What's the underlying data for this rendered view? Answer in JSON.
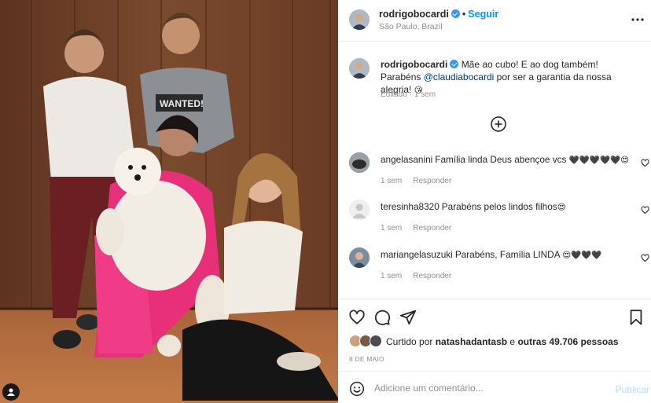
{
  "post": {
    "username": "rodrigobocardi",
    "separator": "•",
    "follow_label": "Seguir",
    "location": "São Paulo, Brazil",
    "photo_alt": "family with dog"
  },
  "caption": {
    "username": "rodrigobocardi",
    "text_a": "Mãe ao cubo! E ao dog também! Parabéns",
    "mention": "@claudiabocardi",
    "text_b": "por ser a garantia da nossa alegria!",
    "emoji": "😘",
    "edited": "Editado",
    "dot": "·",
    "time": "1 sem"
  },
  "comments": [
    {
      "username": "angelasanini",
      "text": "Família linda Deus abençoe vcs",
      "emoji": "🖤🖤🖤🖤🖤😍",
      "time": "1 sem",
      "reply": "Responder",
      "avatar_color": "#3a3a3a"
    },
    {
      "username": "teresinha8320",
      "text": "Parabéns pelos lindos filhos",
      "emoji": "😍",
      "time": "1 sem",
      "reply": "Responder",
      "avatar_color": "#dbdbdb"
    },
    {
      "username": "mariangelasuzuki",
      "text": "Parabéns, Família LINDA",
      "emoji": "😍🖤🖤🖤",
      "time": "1 sem",
      "reply": "Responder",
      "avatar_color": "#5a6b7d"
    }
  ],
  "likes": {
    "prefix": "Curtido por",
    "user": "natashadantasb",
    "middle": "e",
    "others": "outras 49.706 pessoas"
  },
  "date": "8 DE MAIO",
  "comment_box": {
    "placeholder": "Adicione um comentário...",
    "publish_label": "Publicar"
  },
  "colors": {
    "link_blue": "#0095f6",
    "verified_blue": "#3897f0",
    "muted": "#8e8e8e",
    "publish_disabled": "#b2dffc"
  }
}
